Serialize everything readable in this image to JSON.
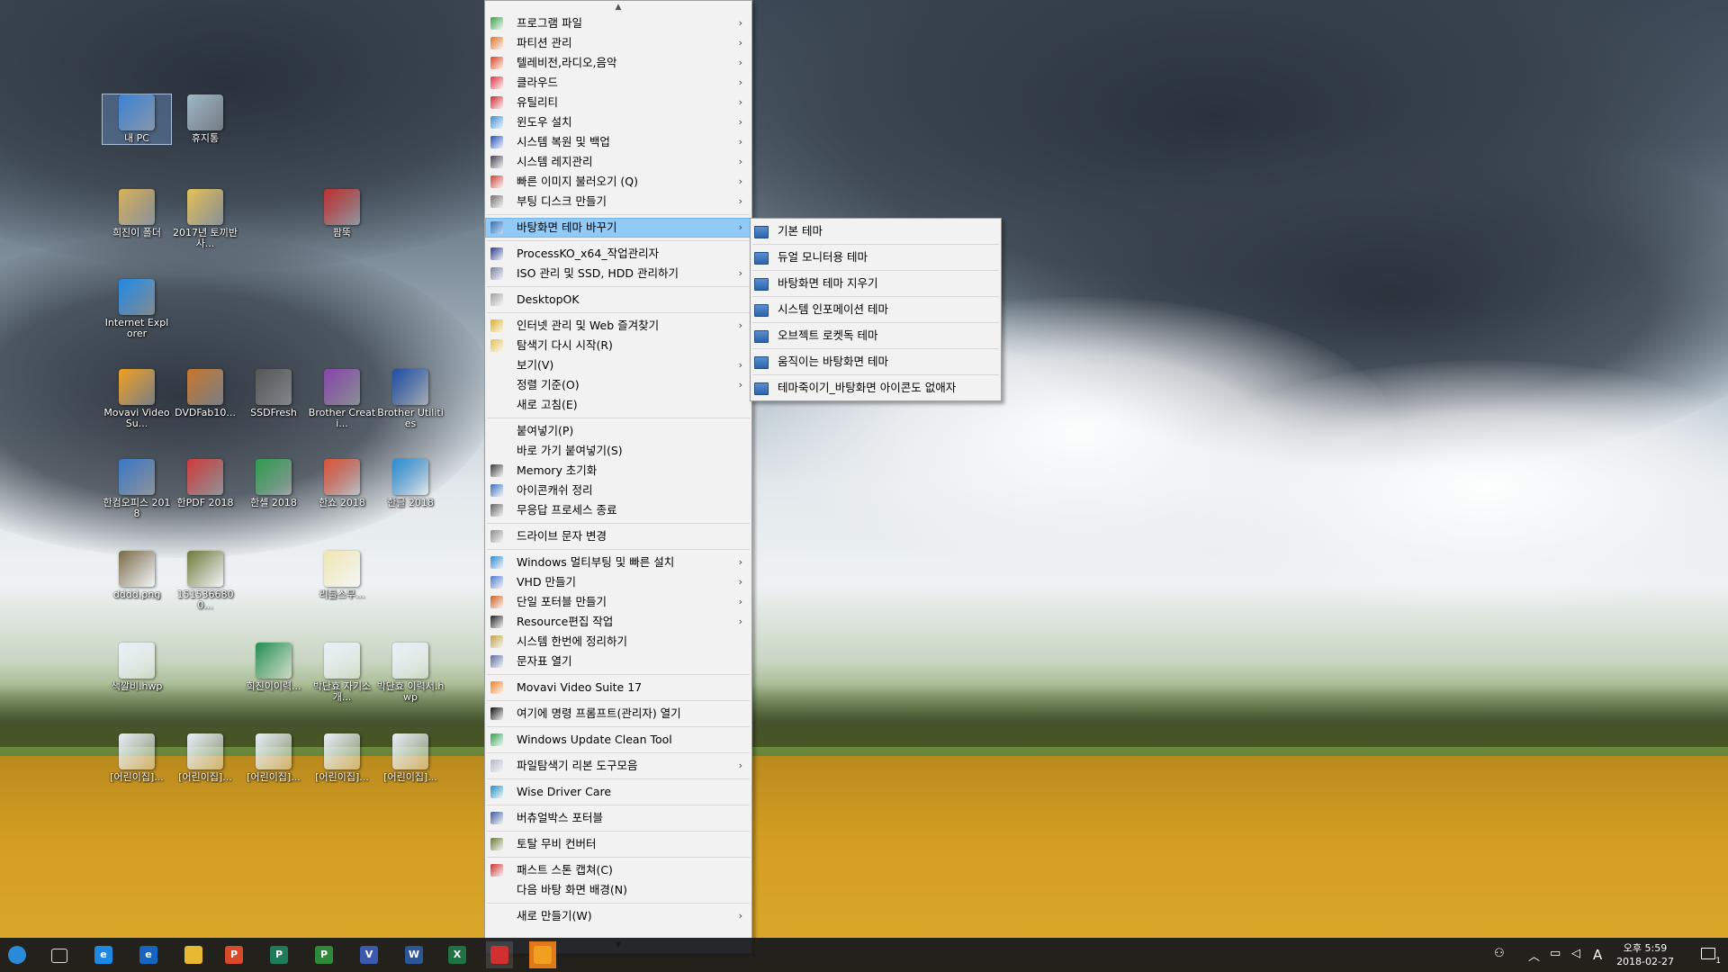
{
  "desktop": {
    "icons": [
      {
        "label": "내 PC",
        "color": "#3b82d6"
      },
      {
        "label": "휴지통",
        "color": "#9fb8c8"
      },
      {
        "label": "희진이 폴더",
        "color": "#d9b25c"
      },
      {
        "label": "2017년 토끼반 사...",
        "color": "#e6c45a"
      },
      {
        "label": "팜뚝",
        "color": "#c03030"
      },
      {
        "label": "Internet Explorer",
        "color": "#1e88e5"
      },
      {
        "label": "Movavi Video Su...",
        "color": "#f0a020"
      },
      {
        "label": "DVDFab10...",
        "color": "#c9762c"
      },
      {
        "label": "SSDFresh",
        "color": "#555555"
      },
      {
        "label": "Brother Creati...",
        "color": "#8844aa"
      },
      {
        "label": "Brother Utilities",
        "color": "#1f4fa8"
      },
      {
        "label": "한컴오피스 2018",
        "color": "#3a78c9"
      },
      {
        "label": "한PDF 2018",
        "color": "#d23a3a"
      },
      {
        "label": "한셀 2018",
        "color": "#2e9e4f"
      },
      {
        "label": "한쇼 2018",
        "color": "#e0553a"
      },
      {
        "label": "한글 2018",
        "color": "#2b8fd6"
      },
      {
        "label": "dddd.png",
        "color": "#7a6a4a"
      },
      {
        "label": "1515366800...",
        "color": "#6a7a3a"
      },
      {
        "label": "리틀스무...",
        "color": "#f0e6b0"
      },
      {
        "label": "색깔비.hwp",
        "color": "#e8f0f8"
      },
      {
        "label": "희진이이력...",
        "color": "#1f8b4c"
      },
      {
        "label": "박단효 자기소개...",
        "color": "#e8f0f8"
      },
      {
        "label": "박단효 이력서.hwp",
        "color": "#e8f0f8"
      },
      {
        "label": "[어린이집]...",
        "color": "#e8f0f8"
      },
      {
        "label": "[어린이집]...",
        "color": "#e8f0f8"
      },
      {
        "label": "[어린이집]...",
        "color": "#e8f0f8"
      },
      {
        "label": "[어린이집]...",
        "color": "#e8f0f8"
      },
      {
        "label": "[어린이집]...",
        "color": "#e8f0f8"
      }
    ]
  },
  "context_menu": {
    "items": [
      {
        "label": "프로그램 파일",
        "arrow": true,
        "icon": "program-files-icon",
        "color": "#3aa04a"
      },
      {
        "label": "파티션 관리",
        "arrow": true,
        "icon": "partition-icon",
        "color": "#e07020"
      },
      {
        "label": "텔레비전,라디오,음악",
        "arrow": true,
        "icon": "tv-radio-icon",
        "color": "#e04020"
      },
      {
        "label": "클라우드",
        "arrow": true,
        "icon": "cloud-icon",
        "color": "#e03040"
      },
      {
        "label": "유틸리티",
        "arrow": true,
        "icon": "utility-icon",
        "color": "#d02828"
      },
      {
        "label": "윈도우 설치",
        "arrow": true,
        "icon": "windows-install-icon",
        "color": "#3a8ad6"
      },
      {
        "label": "시스템 복원 및 백업",
        "arrow": true,
        "icon": "restore-icon",
        "color": "#2050c0"
      },
      {
        "label": "시스템 레지관리",
        "arrow": true,
        "icon": "registry-icon",
        "color": "#404050"
      },
      {
        "label": "빠른 이미지 불러오기 (Q)",
        "arrow": true,
        "icon": "image-icon",
        "color": "#d04030"
      },
      {
        "label": "부팅 디스크 만들기",
        "arrow": true,
        "icon": "boot-disk-icon",
        "color": "#707070"
      },
      {
        "sep": true
      },
      {
        "label": "바탕화면 테마 바꾸기",
        "arrow": true,
        "icon": "theme-icon",
        "color": "#3a6fb0",
        "highlight": true
      },
      {
        "sep": true
      },
      {
        "label": "ProcessKO_x64_작업관리자",
        "arrow": false,
        "icon": "process-icon",
        "color": "#2a3a8a"
      },
      {
        "label": "ISO 관리 및 SSD, HDD 관리하기",
        "arrow": true,
        "icon": "disk-icon",
        "color": "#7080a0"
      },
      {
        "sep": true
      },
      {
        "label": "DesktopOK",
        "arrow": false,
        "icon": "desktopok-icon",
        "color": "#a0a0a0"
      },
      {
        "sep": true
      },
      {
        "label": "인터넷 관리 및 Web 즐겨찾기",
        "arrow": true,
        "icon": "chrome-icon",
        "color": "#e0b020"
      },
      {
        "label": "탐색기 다시 시작(R)",
        "arrow": false,
        "icon": "explorer-icon",
        "color": "#e8c050"
      },
      {
        "label": "보기(V)",
        "arrow": true,
        "icon": "",
        "color": ""
      },
      {
        "label": "정렬 기준(O)",
        "arrow": true,
        "icon": "",
        "color": ""
      },
      {
        "label": "새로 고침(E)",
        "arrow": false,
        "icon": "",
        "color": ""
      },
      {
        "sep": true
      },
      {
        "label": "붙여넣기(P)",
        "arrow": false,
        "icon": "",
        "color": ""
      },
      {
        "label": "바로 가기 붙여넣기(S)",
        "arrow": false,
        "icon": "",
        "color": ""
      },
      {
        "label": "Memory 초기화",
        "arrow": false,
        "icon": "memory-icon",
        "color": "#3a3a3a"
      },
      {
        "label": "아이콘캐쉬 정리",
        "arrow": false,
        "icon": "icon-cache-icon",
        "color": "#3a70c0"
      },
      {
        "label": "무응답 프로세스 종료",
        "arrow": false,
        "icon": "kill-process-icon",
        "color": "#606060"
      },
      {
        "sep": true
      },
      {
        "label": "드라이브 문자 변경",
        "arrow": false,
        "icon": "drive-icon",
        "color": "#8a8a8a"
      },
      {
        "sep": true
      },
      {
        "label": "Windows 멀티부팅 및 빠른 설치",
        "arrow": true,
        "icon": "windows-icon",
        "color": "#2a8ad8"
      },
      {
        "label": "VHD 만들기",
        "arrow": true,
        "icon": "vhd-icon",
        "color": "#4a7ad0"
      },
      {
        "label": "단일 포터블 만들기",
        "arrow": true,
        "icon": "portable-icon",
        "color": "#d06020"
      },
      {
        "label": "Resource편집 작업",
        "arrow": true,
        "icon": "resource-icon",
        "color": "#202020"
      },
      {
        "label": "시스템 한번에 정리하기",
        "arrow": false,
        "icon": "cleanup-icon",
        "color": "#c0a040"
      },
      {
        "label": "문자표 열기",
        "arrow": false,
        "icon": "charmap-icon",
        "color": "#5a6aa0"
      },
      {
        "sep": true
      },
      {
        "label": "Movavi Video Suite 17",
        "arrow": false,
        "icon": "movavi-icon",
        "color": "#f08020"
      },
      {
        "sep": true
      },
      {
        "label": "여기에 명령 프롬프트(관리자) 열기",
        "arrow": false,
        "icon": "cmd-icon",
        "color": "#101010"
      },
      {
        "sep": true
      },
      {
        "label": "Windows Update Clean Tool",
        "arrow": false,
        "icon": "update-clean-icon",
        "color": "#30a050"
      },
      {
        "sep": true
      },
      {
        "label": "파일탐색기 리본 도구모음",
        "arrow": true,
        "icon": "ribbon-icon",
        "color": "#b0b8c8"
      },
      {
        "sep": true
      },
      {
        "label": "Wise Driver Care",
        "arrow": false,
        "icon": "wise-driver-icon",
        "color": "#1e90c8"
      },
      {
        "sep": true
      },
      {
        "label": "버츄얼박스 포터블",
        "arrow": false,
        "icon": "virtualbox-icon",
        "color": "#3a5aa0"
      },
      {
        "sep": true
      },
      {
        "label": "토탈 무비 컨버터",
        "arrow": false,
        "icon": "movie-converter-icon",
        "color": "#6a7a30"
      },
      {
        "sep": true
      },
      {
        "label": "패스트 스톤 캡쳐(C)",
        "arrow": false,
        "icon": "faststone-icon",
        "color": "#d03030"
      },
      {
        "label": "다음 바탕 화면 배경(N)",
        "arrow": false,
        "icon": "",
        "color": ""
      },
      {
        "sep": true
      },
      {
        "label": "새로 만들기(W)",
        "arrow": true,
        "icon": "",
        "color": ""
      }
    ]
  },
  "submenu": {
    "items": [
      {
        "label": "기본 테마"
      },
      {
        "label": "듀얼 모니터용 테마"
      },
      {
        "label": "바탕화면 테마 지우기"
      },
      {
        "label": "시스템 인포메이션 테마"
      },
      {
        "label": "오브젝트 로켓독 테마"
      },
      {
        "label": "움직이는 바탕화면 테마"
      },
      {
        "label": "테마죽이기_바탕화면 아이콘도 없애자"
      }
    ]
  },
  "taskbar": {
    "apps": [
      {
        "name": "start-icon",
        "text": "",
        "color": "#2a8ad8"
      },
      {
        "name": "task-view-icon",
        "text": "",
        "color": "#6a6a6a"
      },
      {
        "name": "ie-icon",
        "text": "e",
        "color": "#1e88e5"
      },
      {
        "name": "edge-icon",
        "text": "e",
        "color": "#1565c0"
      },
      {
        "name": "file-explorer-icon",
        "text": "",
        "color": "#e8b830"
      },
      {
        "name": "hancom-show-icon",
        "text": "P",
        "color": "#d84a2a"
      },
      {
        "name": "publisher-icon",
        "text": "P",
        "color": "#1f7a5a"
      },
      {
        "name": "project-icon",
        "text": "P",
        "color": "#2e8a3a"
      },
      {
        "name": "visio-icon",
        "text": "V",
        "color": "#3a5ab0"
      },
      {
        "name": "word-icon",
        "text": "W",
        "color": "#2b5797"
      },
      {
        "name": "excel-icon",
        "text": "X",
        "color": "#1f7244"
      },
      {
        "name": "browser-icon",
        "text": "",
        "color": "#d03030"
      },
      {
        "name": "chrome-taskbar-icon",
        "text": "",
        "color": "#f0a020"
      }
    ],
    "tray": {
      "ime": "A",
      "time": "오후 5:59",
      "date": "2018-02-27",
      "notification_count": "1"
    }
  }
}
